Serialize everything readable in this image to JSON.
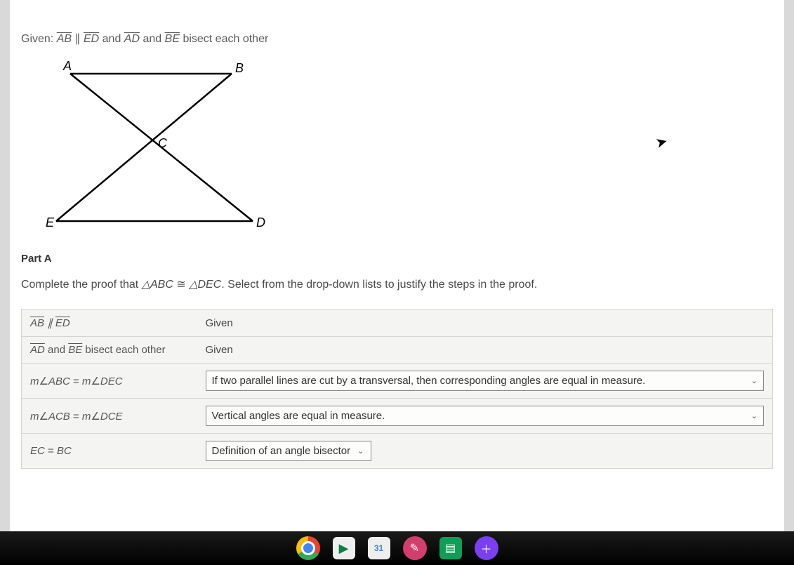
{
  "given": {
    "prefix": "Given:",
    "seg1": "AB",
    "parallel": "∥",
    "seg2": "ED",
    "and1": "and",
    "seg3": "AD",
    "and2": "and",
    "seg4": "BE",
    "suffix": "bisect each other"
  },
  "diagram": {
    "labels": {
      "A": "A",
      "B": "B",
      "C": "C",
      "D": "D",
      "E": "E"
    }
  },
  "part_label": "Part A",
  "instruction": {
    "prefix": "Complete the proof that",
    "tri1": "△ABC",
    "cong": "≅",
    "tri2": "△DEC",
    "suffix": ". Select from the drop-down lists to justify the steps in the proof."
  },
  "proof": {
    "row1": {
      "statement_seg1": "AB",
      "statement_par": "∥",
      "statement_seg2": "ED",
      "reason": "Given"
    },
    "row2": {
      "statement_seg1": "AD",
      "statement_and": "and",
      "statement_seg2": "BE",
      "statement_suffix": "bisect each other",
      "reason": "Given"
    },
    "row3": {
      "statement_prefix": "m",
      "statement_ang1": "ABC",
      "statement_eq": "=",
      "statement_prefix2": "m",
      "statement_ang2": "DEC",
      "reason": "If two parallel lines are cut by a transversal, then corresponding angles are equal in measure."
    },
    "row4": {
      "statement_prefix": "m",
      "statement_ang1": "ACB",
      "statement_eq": "=",
      "statement_prefix2": "m",
      "statement_ang2": "DCE",
      "reason": "Vertical angles are equal in measure."
    },
    "row5": {
      "statement_lhs": "EC",
      "statement_eq": "=",
      "statement_rhs": "BC",
      "reason": "Definition of an angle bisector"
    }
  },
  "taskbar": {
    "cal_day": "31"
  }
}
